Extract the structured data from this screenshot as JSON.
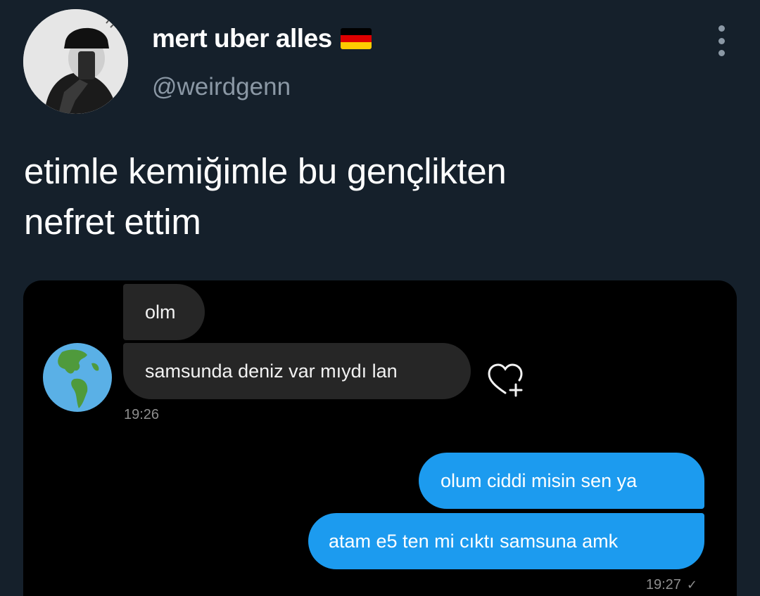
{
  "tweet": {
    "author": {
      "display_name": "mert uber alles",
      "handle": "@weirdgenn",
      "flag": "germany-flag-emoji",
      "flag_colors": [
        "#000000",
        "#dd0000",
        "#ffcc00"
      ]
    },
    "text": "etimle kemiğimle bu gençlikten\nnefret ettim",
    "more_icon": "more-vertical-icon"
  },
  "media": {
    "messages": [
      {
        "direction": "incoming",
        "text": "olm"
      },
      {
        "direction": "incoming",
        "text": "samsunda deniz var mıydı lan",
        "reaction_icon": "heart-add-icon"
      },
      {
        "direction": "outgoing",
        "text": "olum ciddi misin sen ya"
      },
      {
        "direction": "outgoing",
        "text": "atam e5 ten mi cıktı samsuna amk"
      }
    ],
    "incoming_time": "19:26",
    "outgoing_time": "19:27",
    "outgoing_status_icon": "check-icon",
    "sender_avatar_icon": "globe-americas-icon",
    "colors": {
      "incoming_bubble": "#262626",
      "outgoing_bubble": "#1c9bef",
      "background": "#000000"
    }
  },
  "colors": {
    "page_background": "#15202b",
    "primary_text": "#ffffff",
    "secondary_text": "#8b98a5"
  }
}
